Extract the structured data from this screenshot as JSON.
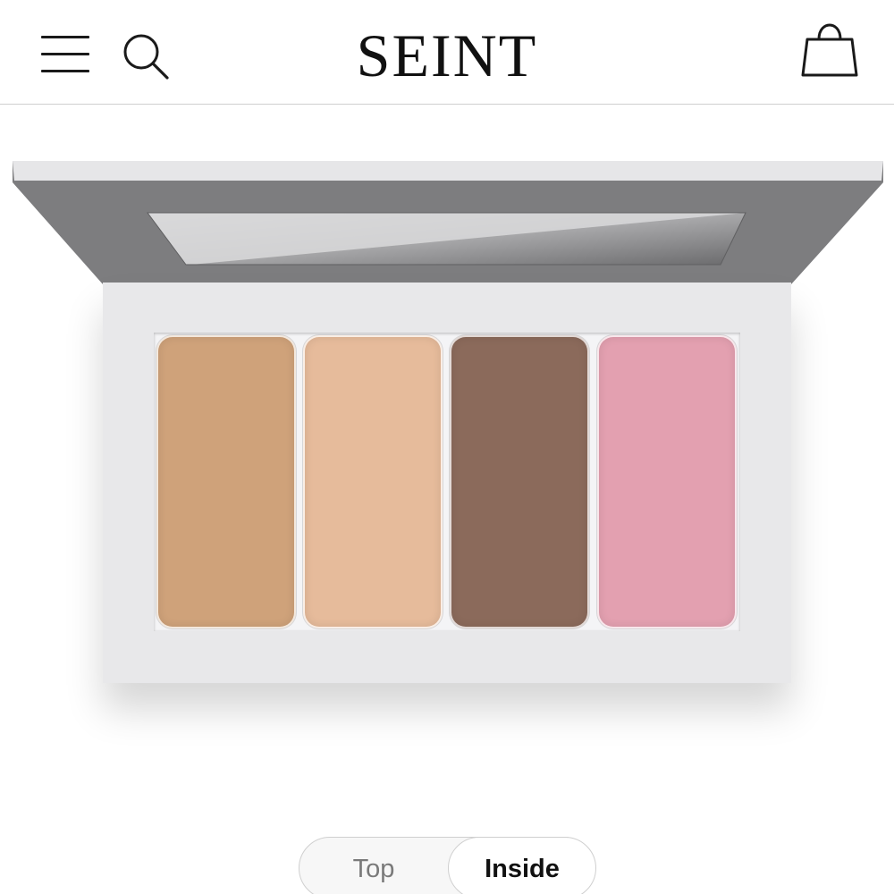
{
  "header": {
    "brand": "SEINT",
    "menu_icon": "hamburger-menu-icon",
    "search_icon": "search-icon",
    "bag_icon": "shopping-bag-icon"
  },
  "palette": {
    "pans": [
      {
        "color": "#cfa27a"
      },
      {
        "color": "#e6bb9b"
      },
      {
        "color": "#8b6a5b"
      },
      {
        "color": "#e3a0b0"
      }
    ]
  },
  "view_toggle": {
    "options": [
      "Top",
      "Inside"
    ],
    "selected": "Inside"
  }
}
